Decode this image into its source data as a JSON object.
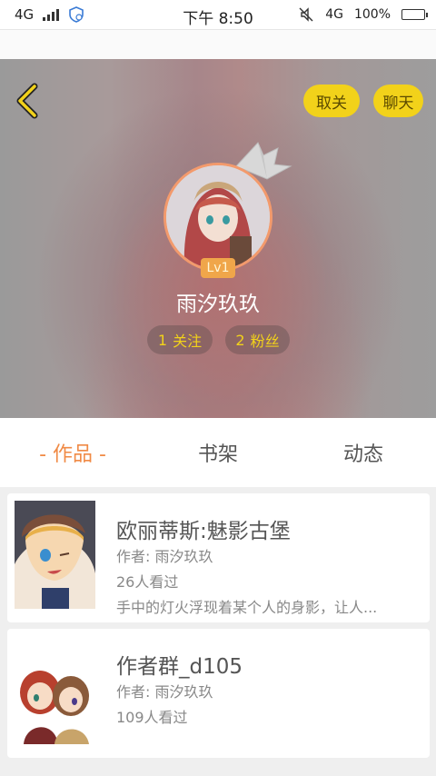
{
  "status_bar": {
    "network_left": "4G",
    "time": "下午 8:50",
    "network_right": "4G",
    "battery": "100%",
    "battery_color": "#35c24a"
  },
  "header": {
    "back_icon": "chevron-left-icon",
    "unfollow_label": "取关",
    "chat_label": "聊天",
    "level": "Lv1",
    "username": "雨汐玖玖",
    "following_count": "1",
    "following_label": "关注",
    "fans_count": "2",
    "fans_label": "粉丝",
    "accent": "#f2d21a"
  },
  "tabs": [
    {
      "label": "- 作品 -",
      "active": true
    },
    {
      "label": "书架",
      "active": false
    },
    {
      "label": "动态",
      "active": false
    }
  ],
  "works": [
    {
      "title": "欧丽蒂斯:魅影古堡",
      "author": "作者: 雨汐玖玖",
      "views": "26人看过",
      "description": "手中的灯火浮现着某个人的身影，让人..."
    },
    {
      "title": "作者群_d105",
      "author": "作者: 雨汐玖玖",
      "views": "109人看过",
      "description": ""
    }
  ],
  "colors": {
    "active_tab": "#f08a45",
    "avatar_border": "#f39a6c",
    "level_badge": "#f0a64a"
  }
}
